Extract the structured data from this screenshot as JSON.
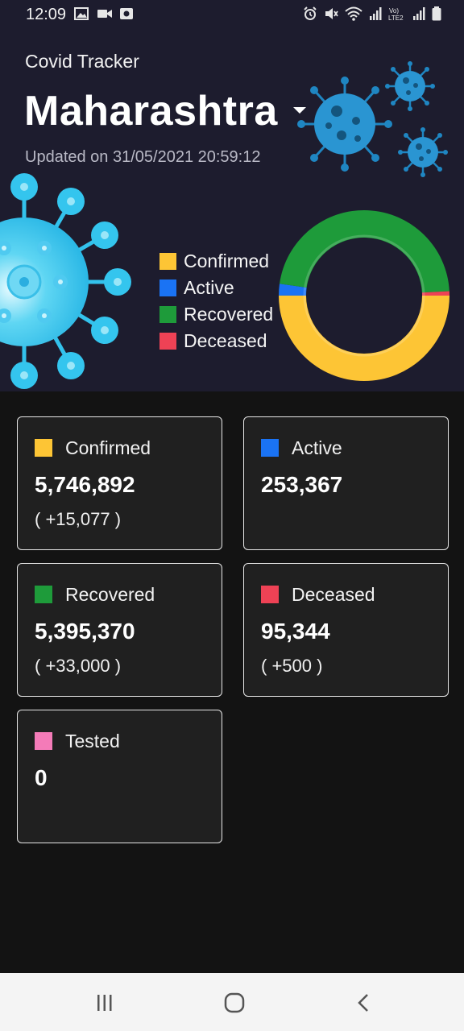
{
  "status_bar": {
    "time": "12:09",
    "left_icons": [
      "image-icon",
      "video-icon",
      "screen-record-icon"
    ],
    "right_icons": [
      "alarm-icon",
      "mute-icon",
      "wifi-icon",
      "signal-icon",
      "volte-icon",
      "signal-icon",
      "battery-icon"
    ]
  },
  "header": {
    "app_title": "Covid Tracker",
    "state": "Maharashtra",
    "updated": "Updated on 31/05/2021 20:59:12"
  },
  "legend": [
    {
      "label": "Confirmed",
      "color": "#fdc535"
    },
    {
      "label": "Active",
      "color": "#1a73f4"
    },
    {
      "label": "Recovered",
      "color": "#1e9b3a"
    },
    {
      "label": "Deceased",
      "color": "#ee4255"
    }
  ],
  "chart_data": {
    "type": "pie",
    "variant": "donut",
    "series": [
      {
        "name": "Confirmed",
        "value": 5746892,
        "color": "#fdc535"
      },
      {
        "name": "Active",
        "value": 253367,
        "color": "#1a73f4"
      },
      {
        "name": "Recovered",
        "value": 5395370,
        "color": "#1e9b3a"
      },
      {
        "name": "Deceased",
        "value": 95344,
        "color": "#ee4255"
      }
    ],
    "legend_position": "left"
  },
  "cards": [
    {
      "label": "Confirmed",
      "value": "5,746,892",
      "delta": "( +15,077 )",
      "color": "#fdc535"
    },
    {
      "label": "Active",
      "value": "253,367",
      "delta": "",
      "color": "#1a73f4"
    },
    {
      "label": "Recovered",
      "value": "5,395,370",
      "delta": "( +33,000 )",
      "color": "#1e9b3a"
    },
    {
      "label": "Deceased",
      "value": "95,344",
      "delta": "( +500 )",
      "color": "#ee4255"
    },
    {
      "label": "Tested",
      "value": "0",
      "delta": "",
      "color": "#f47bb8"
    }
  ],
  "nav": [
    "recents-icon",
    "home-icon",
    "back-icon"
  ]
}
